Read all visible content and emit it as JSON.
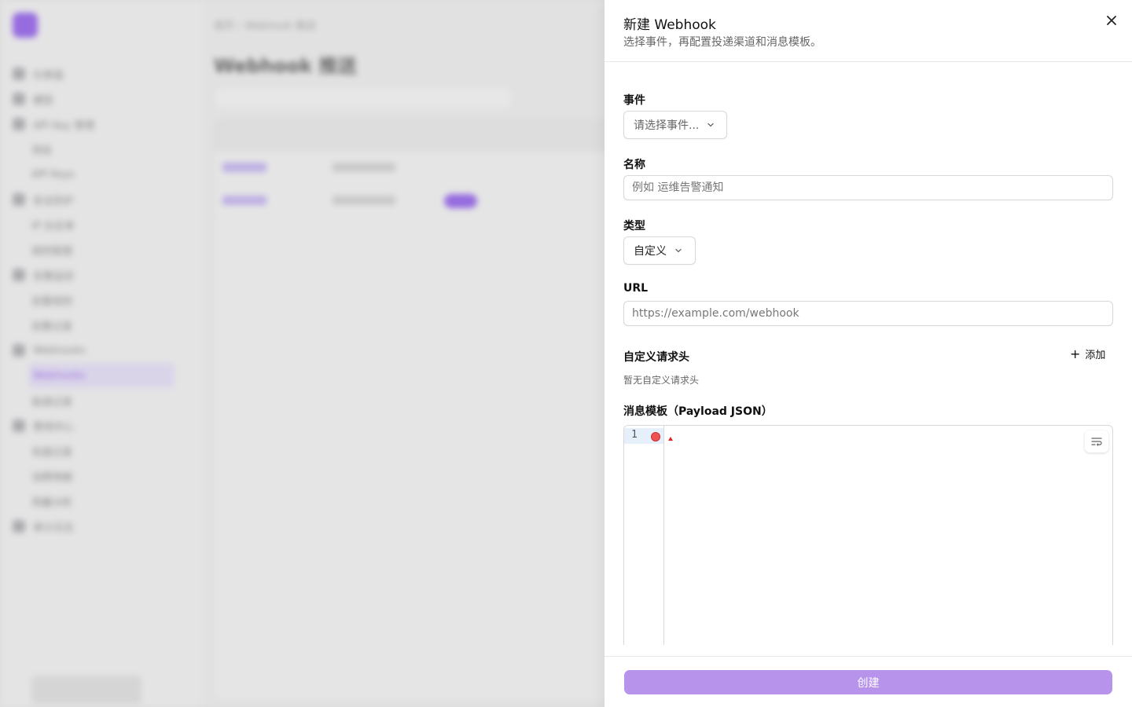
{
  "background_app": {
    "sidebar_nav": [
      {
        "label": "仪表盘",
        "sub": false
      },
      {
        "label": "模型",
        "sub": false
      },
      {
        "label": "API Key 管理",
        "sub": false
      },
      {
        "label": "项目",
        "sub": true
      },
      {
        "label": "API Keys",
        "sub": true
      },
      {
        "label": "安全防护",
        "sub": false
      },
      {
        "label": "IP 白名单",
        "sub": true
      },
      {
        "label": "规则管理",
        "sub": true
      },
      {
        "label": "告警监控",
        "sub": false
      },
      {
        "label": "告警规则",
        "sub": true
      },
      {
        "label": "告警记录",
        "sub": true
      },
      {
        "label": "Webhooks",
        "sub": false
      },
      {
        "label": "Webhooks",
        "sub": true,
        "active": true
      },
      {
        "label": "投递记录",
        "sub": true
      },
      {
        "label": "费用中心",
        "sub": false
      },
      {
        "label": "充值记录",
        "sub": true
      },
      {
        "label": "消费明细",
        "sub": true
      },
      {
        "label": "用量分析",
        "sub": true
      },
      {
        "label": "审计日志",
        "sub": false
      }
    ],
    "breadcrumb": "首页 › Webhook 推送",
    "page_title": "Webhook 推送",
    "accent_color": "#7c3aed"
  },
  "drawer": {
    "title": "新建 Webhook",
    "subtitle": "选择事件，再配置投递渠道和消息模板。",
    "close_icon": "close-icon",
    "event": {
      "label": "事件",
      "placeholder": "请选择事件..."
    },
    "name": {
      "label": "名称",
      "placeholder": "例如 运维告警通知",
      "value": ""
    },
    "type": {
      "label": "类型",
      "value": "自定义"
    },
    "url": {
      "label": "URL",
      "placeholder": "https://example.com/webhook",
      "value": ""
    },
    "headers": {
      "label": "自定义请求头",
      "add_label": "添加",
      "empty_text": "暂无自定义请求头"
    },
    "payload": {
      "label": "消息模板（Payload JSON）",
      "line_number": "1",
      "wrap_icon": "wrap-lines-icon"
    },
    "submit_label": "创建",
    "submit_color": "#b793ec"
  }
}
